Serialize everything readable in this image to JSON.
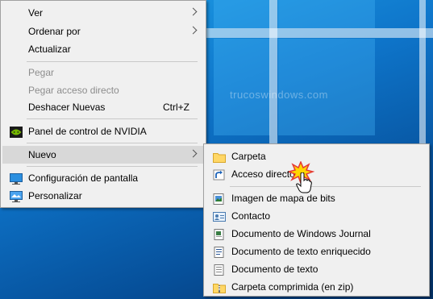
{
  "watermark": "trucoswindows.com",
  "context_menu": {
    "items": [
      {
        "label": "Ver"
      },
      {
        "label": "Ordenar por"
      },
      {
        "label": "Actualizar"
      },
      {
        "label": "Pegar"
      },
      {
        "label": "Pegar acceso directo"
      },
      {
        "label": "Deshacer Nuevas",
        "shortcut": "Ctrl+Z"
      },
      {
        "label": "Panel de control de NVIDIA",
        "icon": "nvidia-icon"
      },
      {
        "label": "Nuevo"
      },
      {
        "label": "Configuración de pantalla",
        "icon": "display-icon"
      },
      {
        "label": "Personalizar",
        "icon": "personalize-icon"
      }
    ]
  },
  "submenu": {
    "items": [
      {
        "label": "Carpeta",
        "icon": "folder-icon"
      },
      {
        "label": "Acceso directo",
        "icon": "shortcut-icon"
      },
      {
        "label": "Imagen de mapa de bits",
        "icon": "bitmap-icon"
      },
      {
        "label": "Contacto",
        "icon": "contact-icon"
      },
      {
        "label": "Documento de Windows Journal",
        "icon": "journal-icon"
      },
      {
        "label": "Documento de texto enriquecido",
        "icon": "rtf-icon"
      },
      {
        "label": "Documento de texto",
        "icon": "text-document-icon"
      },
      {
        "label": "Carpeta comprimida (en zip)",
        "icon": "zip-folder-icon"
      }
    ]
  },
  "colors": {
    "menu_background": "#f0f0f0",
    "highlight": "#d8d8d8",
    "desktop_blue": "#0e74c9"
  }
}
